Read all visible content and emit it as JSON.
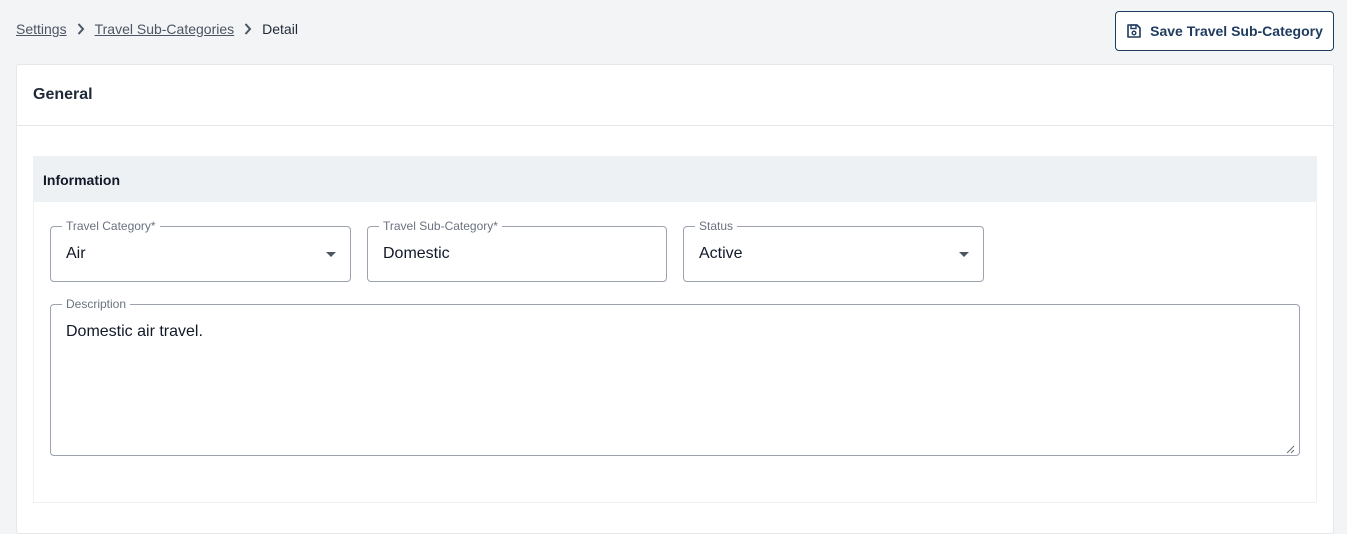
{
  "breadcrumb": {
    "items": [
      "Settings",
      "Travel Sub-Categories"
    ],
    "current": "Detail"
  },
  "toolbar": {
    "save_label": "Save Travel Sub-Category",
    "save_icon": "floppy-disk-icon"
  },
  "card": {
    "title": "General"
  },
  "section": {
    "title": "Information"
  },
  "form": {
    "travel_category": {
      "label": "Travel Category*",
      "value": "Air"
    },
    "travel_sub_category": {
      "label": "Travel Sub-Category*",
      "value": "Domestic"
    },
    "status": {
      "label": "Status",
      "value": "Active"
    },
    "description": {
      "label": "Description",
      "value": "Domestic air travel."
    }
  },
  "colors": {
    "accent": "#1e3a5f",
    "background": "#f3f4f6",
    "section_header": "#eef1f4",
    "border": "#9ca3af"
  }
}
